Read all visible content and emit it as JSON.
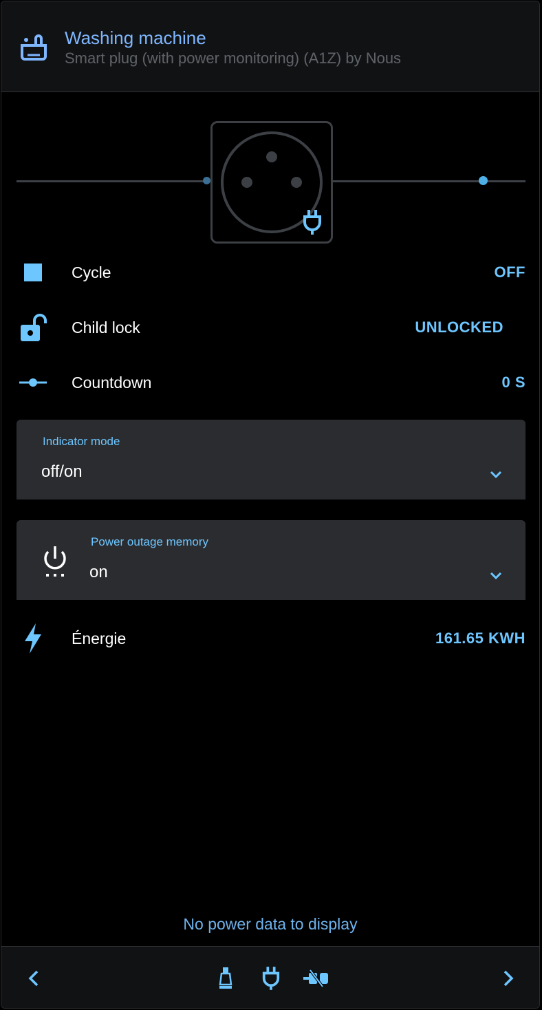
{
  "header": {
    "title": "Washing machine",
    "subtitle": "Smart plug (with power monitoring) (A1Z) by Nous",
    "icon": "washing-machine-icon"
  },
  "diagram": {
    "socket_icon": "power-socket-icon",
    "plug_icon": "power-plug-icon"
  },
  "rows": {
    "cycle": {
      "label": "Cycle",
      "value": "OFF",
      "icon": "stop-square-icon"
    },
    "child_lock": {
      "label": "Child lock",
      "value": "UNLOCKED",
      "icon": "lock-open-icon"
    },
    "countdown": {
      "label": "Countdown",
      "value": "0 S",
      "icon": "slider-icon"
    },
    "energy": {
      "label": "Énergie",
      "value": "161.65 KWH",
      "icon": "lightning-icon"
    }
  },
  "selects": {
    "indicator_mode": {
      "label": "Indicator mode",
      "value": "off/on"
    },
    "power_outage_memory": {
      "label": "Power outage memory",
      "value": "on",
      "icon": "power-settings-icon"
    }
  },
  "power_graph": {
    "empty_text": "No power data to display"
  },
  "colors": {
    "accent": "#6ec6ff",
    "title": "#7fb7ff",
    "panel": "#2a2c30",
    "background": "#000000"
  }
}
